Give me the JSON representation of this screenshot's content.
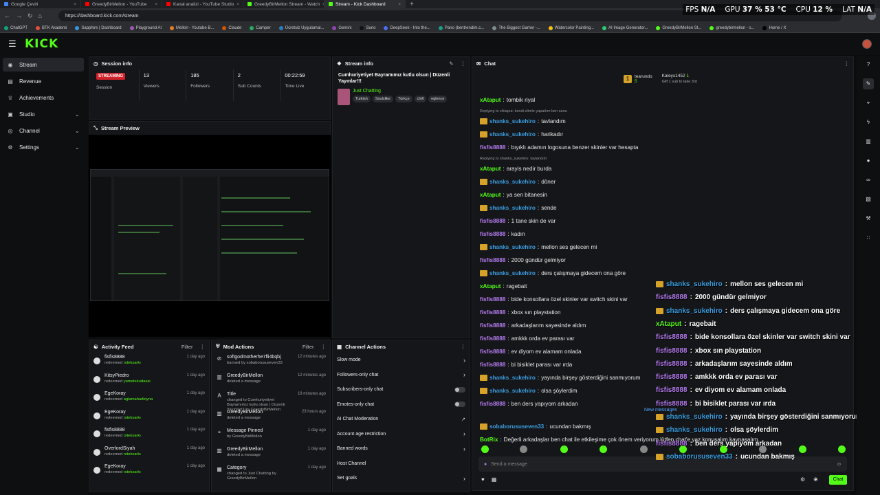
{
  "browser": {
    "tabs": [
      {
        "label": "Google Çeviri",
        "color": "#4285f4"
      },
      {
        "label": "GreedyBirMellon - YouTube",
        "color": "#ff0000"
      },
      {
        "label": "Kanal analizi - YouTube Studio",
        "color": "#ff0000"
      },
      {
        "label": "GreedyBirMellon Stream - Watch",
        "color": "#53fc18"
      },
      {
        "label": "Stream - Kick Dashboard",
        "color": "#53fc18"
      }
    ],
    "url": "https://dashboard.kick.com/stream",
    "bookmarks": [
      "ChatGPT",
      "BTK Akademi",
      "Sapphire | Dashboard",
      "Playground AI",
      "Mellon - Youtube B...",
      "Claude",
      "Camper",
      "Ücretsiz Uygulamal...",
      "Gemini",
      "Suno",
      "DeepSeek - Into the...",
      "Pano (bentrendim.c...",
      "The Biggest Gamer -...",
      "Watercolor Painting...",
      "AI Image Generator...",
      "GreedyBirMellon St...",
      "greedybirmellon - s...",
      "Home / X"
    ]
  },
  "perf_overlay": {
    "fps_label": "FPS",
    "fps": "N/A",
    "gpu_label": "GPU",
    "gpu": "37 % 53 °C",
    "cpu_label": "CPU",
    "cpu": "12 %",
    "lat_label": "LAT",
    "lat": "N/A"
  },
  "logo": "KICK",
  "sidebar": {
    "items": [
      {
        "label": "Stream",
        "icon": "broadcast-icon",
        "active": true,
        "expand": false
      },
      {
        "label": "Revenue",
        "icon": "wallet-icon",
        "active": false,
        "expand": false
      },
      {
        "label": "Achievements",
        "icon": "trophy-icon",
        "active": false,
        "expand": false
      },
      {
        "label": "Studio",
        "icon": "studio-icon",
        "active": false,
        "expand": true
      },
      {
        "label": "Channel",
        "icon": "channel-icon",
        "active": false,
        "expand": true
      },
      {
        "label": "Settings",
        "icon": "gear-icon",
        "active": false,
        "expand": true
      }
    ]
  },
  "session": {
    "title": "Session info",
    "status": "STREAMING",
    "status_label": "Session",
    "stats": [
      {
        "value": "13",
        "label": "Viewers"
      },
      {
        "value": "185",
        "label": "Followers"
      },
      {
        "value": "2",
        "label": "Sub Counts"
      },
      {
        "value": "00:22:59",
        "label": "Time Live"
      }
    ]
  },
  "stream_info": {
    "title": "Stream info",
    "stream_title": "Cumhuriyetiyet Bayramımız kutlu olsun | Düzenli Yayınlar!!!",
    "category": "Just Chatting",
    "tags": [
      "Turkish",
      "Soulslike",
      "Türkçe",
      "chill",
      "eglence"
    ]
  },
  "preview": {
    "title": "Stream Preview"
  },
  "activity": {
    "title": "Activity Feed",
    "filter": "Filter",
    "rows": [
      {
        "user": "fisfis8888",
        "action": "redeemed",
        "item": "rsteksarkı",
        "time": "1 day ago"
      },
      {
        "user": "KitsyPiedro",
        "action": "redeemed",
        "item": "yametekudasai",
        "time": "1 day ago"
      },
      {
        "user": "EgeKoray",
        "action": "redeemed",
        "item": "aglamahadioyna",
        "time": "1 day ago"
      },
      {
        "user": "EgeKoray",
        "action": "redeemed",
        "item": "rsteksarkı",
        "time": "1 day ago"
      },
      {
        "user": "fisfis8888",
        "action": "redeemed",
        "item": "rsteksarkı",
        "time": "1 day ago"
      },
      {
        "user": "OverlordSiyah",
        "action": "redeemed",
        "item": "rsteksarkı",
        "time": "1 day ago"
      },
      {
        "user": "EgeKoray",
        "action": "redeemed",
        "item": "rsteksarkı",
        "time": "1 day ago"
      }
    ]
  },
  "mod_actions": {
    "title": "Mod Actions",
    "filter": "Filter",
    "rows": [
      {
        "main": "softgodmotherhe7fli4bqbj",
        "sub": "banned by sobaborususeven33",
        "time": "12 minutes ago",
        "icon": "ban-icon"
      },
      {
        "main": "GreedyBirMellon",
        "sub": "deleted a message",
        "time": "12 minutes ago",
        "icon": "trash-icon"
      },
      {
        "main": "Title",
        "sub": "changed to Cumhuriyetiyet Bayramımız kutlu olsun | Düzenli Yayınlar!!! by GreedyBirMellon",
        "time": "19 minutes ago",
        "icon": "title-icon"
      },
      {
        "main": "GreedyBirMellon",
        "sub": "deleted a message",
        "time": "23 hours ago",
        "icon": "trash-icon"
      },
      {
        "main": "Message Pinned",
        "sub": "by GreedyBirMellon",
        "time": "1 day ago",
        "icon": "pin-icon"
      },
      {
        "main": "GreedyBirMellon",
        "sub": "deleted a message",
        "time": "1 day ago",
        "icon": "trash-icon"
      },
      {
        "main": "Category",
        "sub": "changed to Just Chatting by GreedyBirMellon",
        "time": "1 day ago",
        "icon": "category-icon"
      }
    ]
  },
  "channel_actions": {
    "title": "Channel Actions",
    "rows": [
      {
        "label": "Slow mode",
        "control": "chevron"
      },
      {
        "label": "Followers-only chat",
        "control": "chevron"
      },
      {
        "label": "Subscribers-only chat",
        "control": "toggle"
      },
      {
        "label": "Emotes-only chat",
        "control": "toggle"
      },
      {
        "label": "AI Chat Moderation",
        "control": "external"
      },
      {
        "label": "Account age restriction",
        "control": "chevron"
      },
      {
        "label": "Banned words",
        "control": "chevron"
      },
      {
        "label": "Host Channel",
        "control": "none"
      },
      {
        "label": "Set goals",
        "control": "chevron"
      }
    ]
  },
  "chat": {
    "title": "Chat",
    "pinned": [
      {
        "name": "tearundo",
        "value": "5"
      },
      {
        "name": "Kaleys1452",
        "value": "1",
        "note": "Gift 1 sub to take 3rd"
      }
    ],
    "messages": [
      {
        "user": "xAtaput",
        "color": "#53fc18",
        "text": "tombik riyal",
        "crown": false,
        "reply": ""
      },
      {
        "user": "shanks_sukehiro",
        "color": "#3b9ee0",
        "text": "tavlandım",
        "crown": true,
        "reply": "Replying to xAtaput: kendi elimle yaparlım ben sana"
      },
      {
        "user": "shanks_sukehiro",
        "color": "#3b9ee0",
        "text": "harikadır",
        "crown": true,
        "reply": ""
      },
      {
        "user": "fisfis8888",
        "color": "#b57bf0",
        "text": "bıyıklı adamın logosuna benzer skinler var hesapta",
        "crown": false,
        "reply": ""
      },
      {
        "user": "xAtaput",
        "color": "#53fc18",
        "text": "arayis nedir burda",
        "crown": false,
        "reply": "Replying to shanks_sukehiro: tavlandım"
      },
      {
        "user": "shanks_sukehiro",
        "color": "#3b9ee0",
        "text": "döner",
        "crown": true,
        "reply": ""
      },
      {
        "user": "xAtaput",
        "color": "#53fc18",
        "text": "ya sen bitanesin",
        "crown": false,
        "reply": ""
      },
      {
        "user": "shanks_sukehiro",
        "color": "#3b9ee0",
        "text": "sende",
        "crown": true,
        "reply": ""
      },
      {
        "user": "fisfis8888",
        "color": "#b57bf0",
        "text": "1 tane skin de var",
        "crown": false,
        "reply": ""
      },
      {
        "user": "fisfis8888",
        "color": "#b57bf0",
        "text": "kadın",
        "crown": false,
        "reply": ""
      },
      {
        "user": "shanks_sukehiro",
        "color": "#3b9ee0",
        "text": "mellon ses gelecen mi",
        "crown": true,
        "reply": ""
      },
      {
        "user": "fisfis8888",
        "color": "#b57bf0",
        "text": "2000 gündür gelmiyor",
        "crown": false,
        "reply": ""
      },
      {
        "user": "shanks_sukehiro",
        "color": "#3b9ee0",
        "text": "ders çalışmaya gidecem ona göre",
        "crown": true,
        "reply": ""
      },
      {
        "user": "xAtaput",
        "color": "#53fc18",
        "text": "ragebait",
        "crown": false,
        "reply": ""
      },
      {
        "user": "fisfis8888",
        "color": "#b57bf0",
        "text": "bide konsollara özel skinler var switch skini var",
        "crown": false,
        "reply": ""
      },
      {
        "user": "fisfis8888",
        "color": "#b57bf0",
        "text": "xbox sın playstation",
        "crown": false,
        "reply": ""
      },
      {
        "user": "fisfis8888",
        "color": "#b57bf0",
        "text": "arkadaşlarım sayesinde aldım",
        "crown": false,
        "reply": ""
      },
      {
        "user": "fisfis8888",
        "color": "#b57bf0",
        "text": "amkkk orda ev parası var",
        "crown": false,
        "reply": ""
      },
      {
        "user": "fisfis8888",
        "color": "#b57bf0",
        "text": "ev diyom ev alamam onlada",
        "crown": false,
        "reply": ""
      },
      {
        "user": "fisfis8888",
        "color": "#b57bf0",
        "text": "bi bisiklet parası var ırda",
        "crown": false,
        "reply": ""
      },
      {
        "user": "shanks_sukehiro",
        "color": "#3b9ee0",
        "text": "yayında birşey gösterdiğini sanmıyorum",
        "crown": true,
        "reply": ""
      },
      {
        "user": "shanks_sukehiro",
        "color": "#3b9ee0",
        "text": "olsa şöylerdim",
        "crown": true,
        "reply": ""
      },
      {
        "user": "fisfis8888",
        "color": "#b57bf0",
        "text": "ben ders yapıyom arkadan",
        "crown": false,
        "reply": ""
      },
      {
        "user": "sobaborususeven33",
        "color": "#3b9ee0",
        "text": "ucundan bakmış",
        "crown": true,
        "reply": ""
      },
      {
        "user": "BotRix",
        "color": "#53fc18",
        "text": "Değerli arkadaşlar ben chat ile etkileşime çok önem veriyorum lütfen chat'e yaz konuşalım kaynaşalım.",
        "crown": false,
        "reply": ""
      }
    ],
    "new_messages": "New messages",
    "input_placeholder": "Send a message",
    "send": "Chat"
  },
  "overlay_chat": [
    {
      "user": "shanks_sukehiro",
      "color": "#3b9ee0",
      "text": "mellon ses gelecen mi",
      "crown": true
    },
    {
      "user": "fisfis8888",
      "color": "#b57bf0",
      "text": "2000 gündür gelmiyor",
      "crown": false
    },
    {
      "user": "shanks_sukehiro",
      "color": "#3b9ee0",
      "text": "ders çalışmaya gidecem ona göre",
      "crown": true
    },
    {
      "user": "xAtaput",
      "color": "#53fc18",
      "text": "ragebait",
      "crown": false
    },
    {
      "user": "fisfis8888",
      "color": "#b57bf0",
      "text": "bide konsollara özel skinler var switch skini var",
      "crown": false
    },
    {
      "user": "fisfis8888",
      "color": "#b57bf0",
      "text": "xbox sın playstation",
      "crown": false
    },
    {
      "user": "fisfis8888",
      "color": "#b57bf0",
      "text": "arkadaşlarım sayesinde aldım",
      "crown": false
    },
    {
      "user": "fisfis8888",
      "color": "#b57bf0",
      "text": "amkkk orda ev parası var",
      "crown": false
    },
    {
      "user": "fisfis8888",
      "color": "#b57bf0",
      "text": "ev diyom ev alamam onlada",
      "crown": false
    },
    {
      "user": "fisfis8888",
      "color": "#b57bf0",
      "text": "bi bisiklet parası var ırda",
      "crown": false
    },
    {
      "user": "shanks_sukehiro",
      "color": "#3b9ee0",
      "text": "yayında birşey gösterdiğini sanmıyorum",
      "crown": true
    },
    {
      "user": "shanks_sukehiro",
      "color": "#3b9ee0",
      "text": "olsa şöylerdim",
      "crown": true
    },
    {
      "user": "fisfis8888",
      "color": "#b57bf0",
      "text": "ben ders yapıyom arkadan",
      "crown": false
    },
    {
      "user": "sobaborususeven33",
      "color": "#3b9ee0",
      "text": "ucundan bakmış",
      "crown": true
    }
  ],
  "right_toolbar": [
    "help-icon",
    "pencil-icon",
    "crop-icon",
    "bolt-icon",
    "trash-icon",
    "chat-bubble-icon",
    "link-icon",
    "save-icon",
    "wrench-icon",
    "apps-icon"
  ],
  "colors": {
    "accent": "#53fc18",
    "live": "#d1222c",
    "panel": "#151619",
    "background": "#0b0c0d"
  }
}
